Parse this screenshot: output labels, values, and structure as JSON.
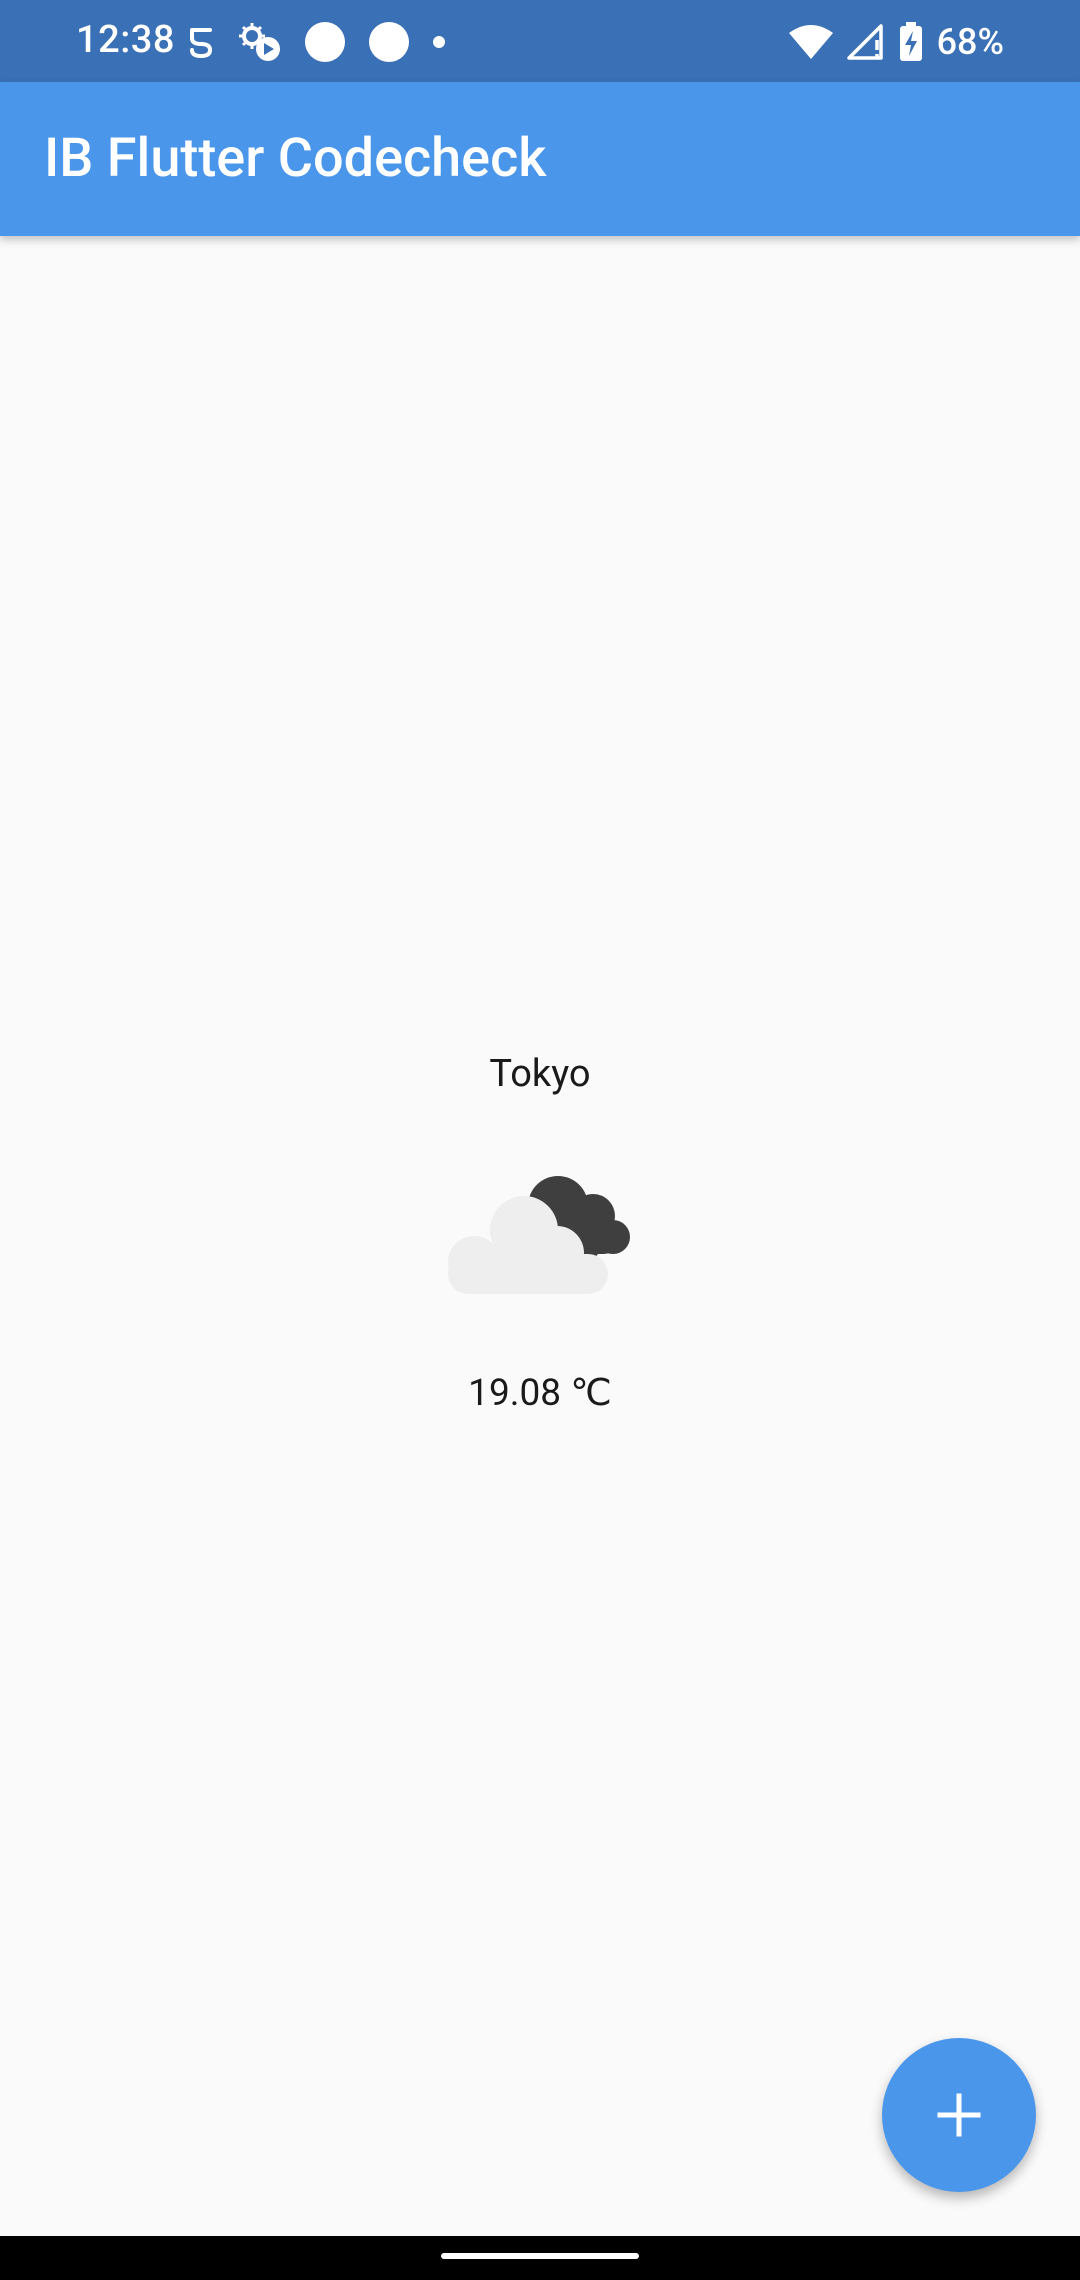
{
  "status_bar": {
    "time": "12:38",
    "battery_percent": "68%",
    "icons_left": [
      "lens-icon",
      "weather-sync-icon",
      "notification-dot-icon",
      "notification-dot-icon",
      "more-dot-icon"
    ],
    "icons_right": [
      "wifi-icon",
      "signal-icon",
      "battery-charging-icon"
    ]
  },
  "app_bar": {
    "title": "IB Flutter Codecheck",
    "color": "#4a96eb"
  },
  "weather": {
    "city": "Tokyo",
    "condition_icon": "cloudy-night-icon",
    "temperature": "19.08 ℃"
  },
  "fab": {
    "icon": "plus-icon"
  },
  "colors": {
    "status_bar": "#3a70b5",
    "primary": "#4a96eb",
    "background": "#fafafa"
  }
}
